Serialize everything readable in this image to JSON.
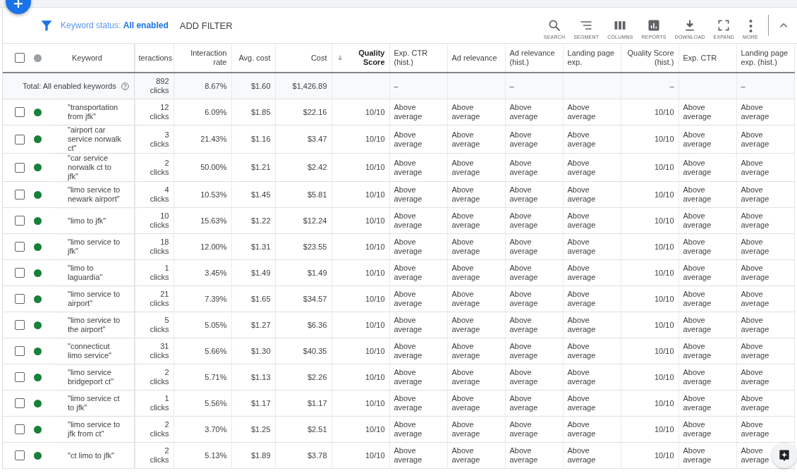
{
  "filter": {
    "text": "Keyword status: **All enabled**",
    "add_label": "ADD FILTER"
  },
  "tools": [
    {
      "kind": "search",
      "label": "SEARCH"
    },
    {
      "kind": "segment",
      "label": "SEGMENT"
    },
    {
      "kind": "columns",
      "label": "COLUMNS"
    },
    {
      "kind": "reports",
      "label": "REPORTS"
    },
    {
      "kind": "download",
      "label": "DOWNLOAD"
    },
    {
      "kind": "expand",
      "label": "EXPAND"
    },
    {
      "kind": "more",
      "label": "MORE"
    }
  ],
  "table": {
    "header_checked": false,
    "columns": [
      {
        "label": "Keyword",
        "sorted": false
      },
      {
        "label": "teractions",
        "sorted": false
      },
      {
        "label": "Interaction rate",
        "sorted": false
      },
      {
        "label": "Avg. cost",
        "sorted": false
      },
      {
        "label": "Cost",
        "sorted": false
      },
      {
        "label": "Quality Score",
        "sorted": true
      },
      {
        "label": "Exp. CTR (hist.)",
        "sorted": false
      },
      {
        "label": "Ad relevance",
        "sorted": false
      },
      {
        "label": "Ad relevance (hist.)",
        "sorted": false
      },
      {
        "label": "Landing page exp.",
        "sorted": false
      },
      {
        "label": "Quality Score (hist.)",
        "sorted": false
      },
      {
        "label": "Exp. CTR",
        "sorted": false
      },
      {
        "label": "Landing page exp. (hist.)",
        "sorted": false
      }
    ],
    "total": {
      "cells": [
        "Total: All enabled keywords",
        "892 clicks",
        "8.67%",
        "$1.60",
        "$1,426.89",
        null,
        "–",
        null,
        "–",
        null,
        "–",
        null,
        "–"
      ]
    },
    "rows": [
      {
        "checked": false,
        "color": "#188038",
        "cells": [
          "\"transportation from jfk\"",
          "12 clicks",
          "6.09%",
          "$1.85",
          "$22.16",
          "10/10",
          "Above average",
          "Above average",
          "Above average",
          "Above average",
          "10/10",
          "Above average",
          "Above average"
        ]
      },
      {
        "checked": false,
        "color": "#188038",
        "cells": [
          "\"airport car service norwalk ct\"",
          "3 clicks",
          "21.43%",
          "$1.16",
          "$3.47",
          "10/10",
          "Above average",
          "Above average",
          "Above average",
          "Above average",
          "10/10",
          "Above average",
          "Above average"
        ]
      },
      {
        "checked": false,
        "color": "#188038",
        "cells": [
          "\"car service norwalk ct to jfk\"",
          "2 clicks",
          "50.00%",
          "$1.21",
          "$2.42",
          "10/10",
          "Above average",
          "Above average",
          "Above average",
          "Above average",
          "10/10",
          "Above average",
          "Above average"
        ]
      },
      {
        "checked": false,
        "color": "#188038",
        "cells": [
          "\"limo service to newark airport\"",
          "4 clicks",
          "10.53%",
          "$1.45",
          "$5.81",
          "10/10",
          "Above average",
          "Above average",
          "Above average",
          "Above average",
          "10/10",
          "Above average",
          "Above average"
        ]
      },
      {
        "checked": false,
        "color": "#188038",
        "cells": [
          "\"limo to jfk\"",
          "10 clicks",
          "15.63%",
          "$1.22",
          "$12.24",
          "10/10",
          "Above average",
          "Above average",
          "Above average",
          "Above average",
          "10/10",
          "Above average",
          "Above average"
        ]
      },
      {
        "checked": false,
        "color": "#188038",
        "cells": [
          "\"limo service to jfk\"",
          "18 clicks",
          "12.00%",
          "$1.31",
          "$23.55",
          "10/10",
          "Above average",
          "Above average",
          "Above average",
          "Above average",
          "10/10",
          "Above average",
          "Above average"
        ]
      },
      {
        "checked": false,
        "color": "#188038",
        "cells": [
          "\"limo to laguardia\"",
          "1 clicks",
          "3.45%",
          "$1.49",
          "$1.49",
          "10/10",
          "Above average",
          "Above average",
          "Above average",
          "Above average",
          "10/10",
          "Above average",
          "Above average"
        ]
      },
      {
        "checked": false,
        "color": "#188038",
        "cells": [
          "\"limo service to airport\"",
          "21 clicks",
          "7.39%",
          "$1.65",
          "$34.57",
          "10/10",
          "Above average",
          "Above average",
          "Above average",
          "Above average",
          "10/10",
          "Above average",
          "Above average"
        ]
      },
      {
        "checked": false,
        "color": "#188038",
        "cells": [
          "\"limo service to the airport\"",
          "5 clicks",
          "5.05%",
          "$1.27",
          "$6.36",
          "10/10",
          "Above average",
          "Above average",
          "Above average",
          "Above average",
          "10/10",
          "Above average",
          "Above average"
        ]
      },
      {
        "checked": false,
        "color": "#188038",
        "cells": [
          "\"connecticut limo service\"",
          "31 clicks",
          "5.66%",
          "$1.30",
          "$40.35",
          "10/10",
          "Above average",
          "Above average",
          "Above average",
          "Above average",
          "10/10",
          "Above average",
          "Above average"
        ]
      },
      {
        "checked": false,
        "color": "#188038",
        "cells": [
          "\"limo service bridgeport ct\"",
          "2 clicks",
          "5.71%",
          "$1.13",
          "$2.26",
          "10/10",
          "Above average",
          "Above average",
          "Above average",
          "Above average",
          "10/10",
          "Above average",
          "Above average"
        ]
      },
      {
        "checked": false,
        "color": "#188038",
        "cells": [
          "\"limo service ct to jfk\"",
          "1 clicks",
          "5.56%",
          "$1.17",
          "$1.17",
          "10/10",
          "Above average",
          "Above average",
          "Above average",
          "Above average",
          "10/10",
          "Above average",
          "Above average"
        ]
      },
      {
        "checked": false,
        "color": "#188038",
        "cells": [
          "\"limo service to jfk from ct\"",
          "2 clicks",
          "3.70%",
          "$1.25",
          "$2.51",
          "10/10",
          "Above average",
          "Above average",
          "Above average",
          "Above average",
          "10/10",
          "Above average",
          "Above average"
        ]
      },
      {
        "checked": false,
        "color": "#188038",
        "cells": [
          "\"ct limo to jfk\"",
          "2 clicks",
          "5.13%",
          "$1.89",
          "$3.78",
          "10/10",
          "Above average",
          "Above average",
          "Above average",
          "Above average",
          "10/10",
          "Above average",
          "Above average"
        ]
      }
    ]
  }
}
